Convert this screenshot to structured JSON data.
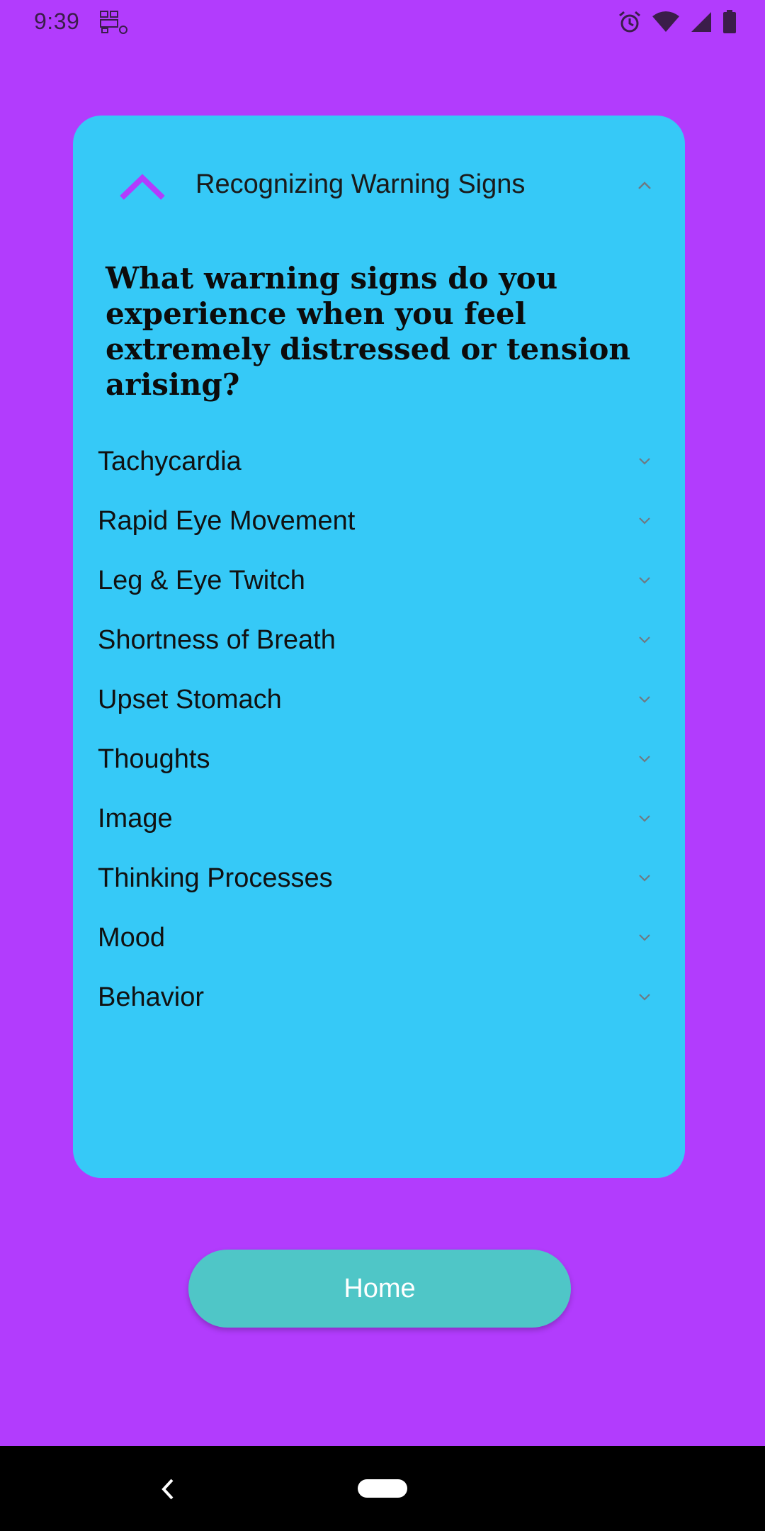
{
  "status_bar": {
    "time": "9:39",
    "icons": [
      "notification-icon",
      "alarm-icon",
      "wifi-icon",
      "signal-icon",
      "battery-icon"
    ]
  },
  "card": {
    "header": {
      "title": "Recognizing Warning Signs",
      "expanded": true
    },
    "question": "What warning signs do you experience when you feel extremely distressed or tension arising?",
    "items": [
      {
        "label": "Tachycardia"
      },
      {
        "label": "Rapid Eye Movement"
      },
      {
        "label": "Leg & Eye Twitch"
      },
      {
        "label": "Shortness of Breath"
      },
      {
        "label": "Upset Stomach"
      },
      {
        "label": "Thoughts"
      },
      {
        "label": "Image"
      },
      {
        "label": "Thinking Processes"
      },
      {
        "label": "Mood"
      },
      {
        "label": "Behavior"
      }
    ]
  },
  "home_button": {
    "label": "Home"
  },
  "colors": {
    "background": "#b23cfd",
    "card": "#36c9f7",
    "accent": "#b23cfd",
    "button": "#4fc6c7",
    "nav_bar": "#000000"
  }
}
